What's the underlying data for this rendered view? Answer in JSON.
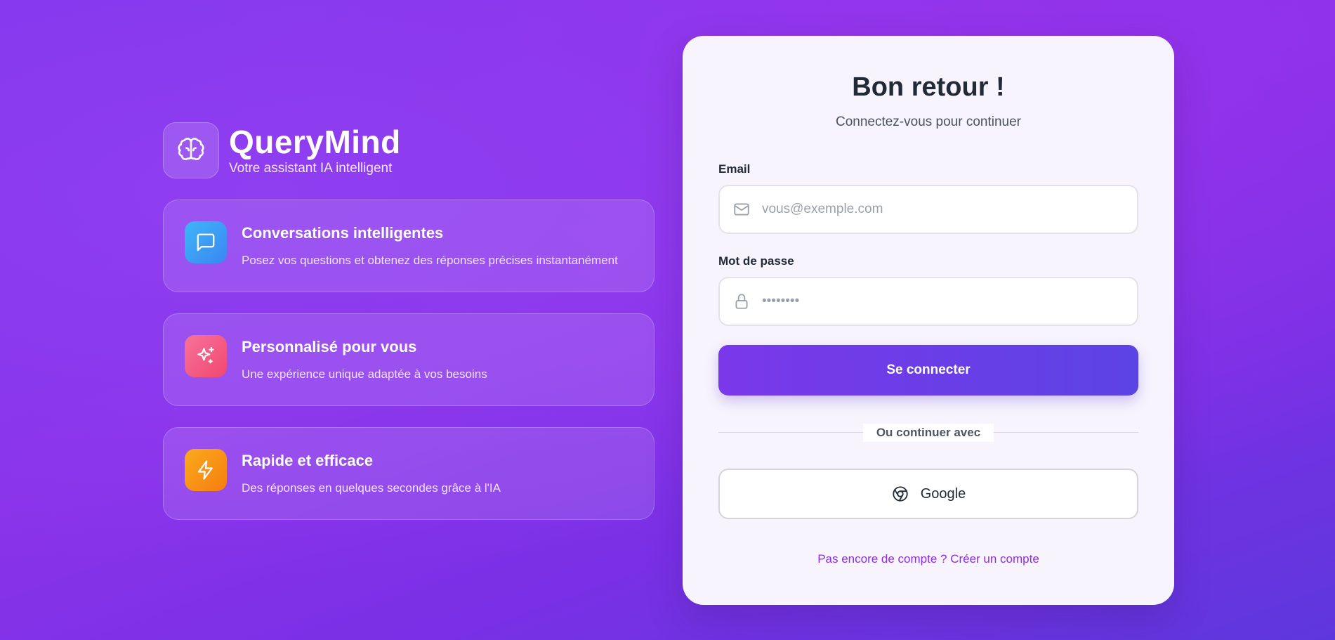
{
  "brand": {
    "name": "QueryMind",
    "tagline": "Votre assistant IA intelligent",
    "logo_icon": "brain-icon"
  },
  "features": [
    {
      "title": "Conversations intelligentes",
      "description": "Posez vos questions et obtenez des réponses précises instantanément",
      "icon": "chat-bubble-icon",
      "icon_gradient": [
        "#3fb6f7",
        "#3a86f2"
      ]
    },
    {
      "title": "Personnalisé pour vous",
      "description": "Une expérience unique adaptée à vos besoins",
      "icon": "sparkles-icon",
      "icon_gradient": [
        "#f7729b",
        "#f1486e"
      ]
    },
    {
      "title": "Rapide et efficace",
      "description": "Des réponses en quelques secondes grâce à l'IA",
      "icon": "lightning-icon",
      "icon_gradient": [
        "#fbaa1d",
        "#f57d0f"
      ]
    }
  ],
  "login": {
    "title": "Bon retour !",
    "subtitle": "Connectez-vous pour continuer",
    "email_label": "Email",
    "email_placeholder": "vous@exemple.com",
    "password_label": "Mot de passe",
    "password_placeholder": "••••••••",
    "submit_label": "Se connecter",
    "divider_text": "Ou continuer avec",
    "google_label": "Google",
    "signup_text": "Pas encore de compte ? Créer un compte"
  },
  "colors": {
    "accent": "#7a38ea",
    "link": "#8a2fe0",
    "card_bg": "#f7f4fd"
  }
}
